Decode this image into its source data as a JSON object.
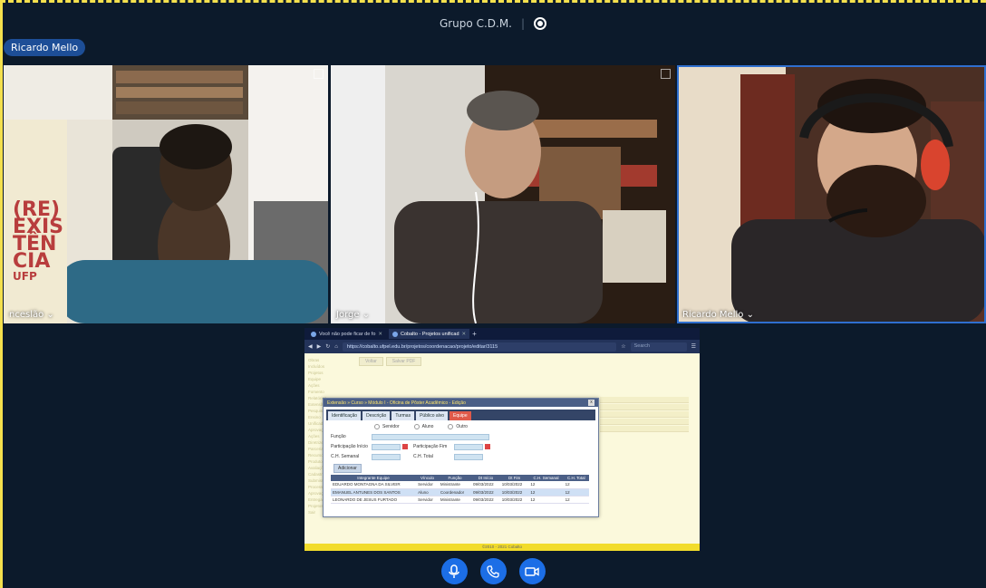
{
  "room": {
    "title": "Grupo C.D.M.",
    "separator": "|"
  },
  "active_speaker": "Ricardo Mello",
  "participants": [
    {
      "label": "nceslão"
    },
    {
      "label": "Jorge"
    },
    {
      "label": "Ricardo Mello"
    }
  ],
  "tile_caret": "⌄",
  "poster_text": {
    "line1": "(RE)",
    "line2": "EXIS",
    "line3": "TÊN",
    "line4": "CIA",
    "line5": "UFP"
  },
  "shared_screen": {
    "browser": {
      "tab1": "Você não pode ficar de fo",
      "tab2": "Cobalto - Projetos unificad",
      "close_glyph": "✕",
      "new_tab_glyph": "+",
      "url": "https://cobalto.ufpel.edu.br/projetos/coordenacao/projeto/editar/3115",
      "search_placeholder": "Search"
    },
    "bg_toolbar": [
      "Voltar",
      "Salvar PDF"
    ],
    "bg_tree": [
      "Obras",
      "Incluídos",
      "Projetos",
      "Equipe",
      "Ações",
      "Fomento",
      "Relatórios",
      "Extensão",
      "Pesquisa",
      "Ensino",
      "Unificados",
      "Aprovação",
      "Ações",
      "Diretrizes",
      "Parcerias",
      "Recursos",
      "Produtos",
      "Avaliações",
      "Cadastros",
      "Submissões",
      "Processos",
      "Aprovação",
      "Entregas",
      "Projetos unificados",
      "Sair"
    ],
    "footer": "©2010 - 2021 Cobalto",
    "modal": {
      "title": "Extensão » Curso » Módulo I - Oficina de Pôster Acadêmico - Edição",
      "close_glyph": "x",
      "tabs": [
        "Identificação",
        "Descrição",
        "Turmas",
        "Público alvo",
        "Equipe"
      ],
      "radios": [
        "Servidor",
        "Aluno",
        "Outro"
      ],
      "fields": {
        "funcao": "Função",
        "participacao_inicio": "Participação Início",
        "participacao_fim": "Participação Fim",
        "ch_semanal": "C.H. Semanal",
        "ch_total": "C.H. Total"
      },
      "add_button": "Adicionar",
      "table": {
        "headers": [
          "Integrante Equipe",
          "Vínculo",
          "Função",
          "Dt Início",
          "Dt Fim",
          "C.H. Semanal",
          "C.H. Total"
        ],
        "rows": [
          [
            "EDUARDO MONTAGNA DA SILVEIR",
            "Servidor",
            "Ministrante",
            "09/03/2022",
            "10/03/2022",
            "12",
            "12"
          ],
          [
            "EMANUEL ANTUNES DOS SANTOS",
            "Aluno",
            "Coordenador",
            "09/03/2022",
            "10/03/2022",
            "12",
            "12"
          ],
          [
            "LEONARDO DE JESUS FURTADO",
            "Servidor",
            "Ministrante",
            "09/03/2022",
            "10/03/2022",
            "12",
            "12"
          ]
        ]
      }
    }
  },
  "controls": [
    "microphone-icon",
    "phone-icon",
    "camera-icon"
  ],
  "colors": {
    "accent": "#1c6ee6",
    "background": "#0c1a2b",
    "active_border": "#2f6fcf"
  }
}
